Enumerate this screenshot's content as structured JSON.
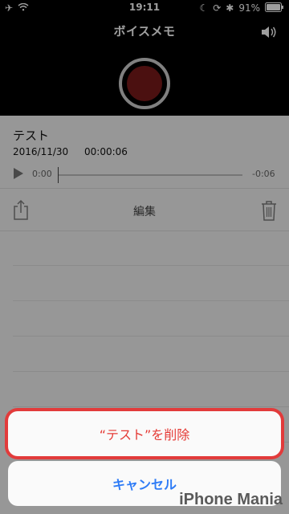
{
  "status": {
    "time": "19:11",
    "battery": "91%"
  },
  "nav": {
    "title": "ボイスメモ"
  },
  "recording": {
    "title": "テスト",
    "date": "2016/11/30",
    "duration": "00:00:06",
    "elapsed": "0:00",
    "remaining": "-0:06",
    "progress": 0
  },
  "toolbar": {
    "edit_label": "編集"
  },
  "sheet": {
    "delete_label": "“テスト”を削除",
    "cancel_label": "キャンセル"
  },
  "watermark": {
    "text": "iPhone Mania"
  },
  "colors": {
    "destructive": "#e53a35",
    "action": "#2f7cf6",
    "highlight": "#e23b3b"
  }
}
